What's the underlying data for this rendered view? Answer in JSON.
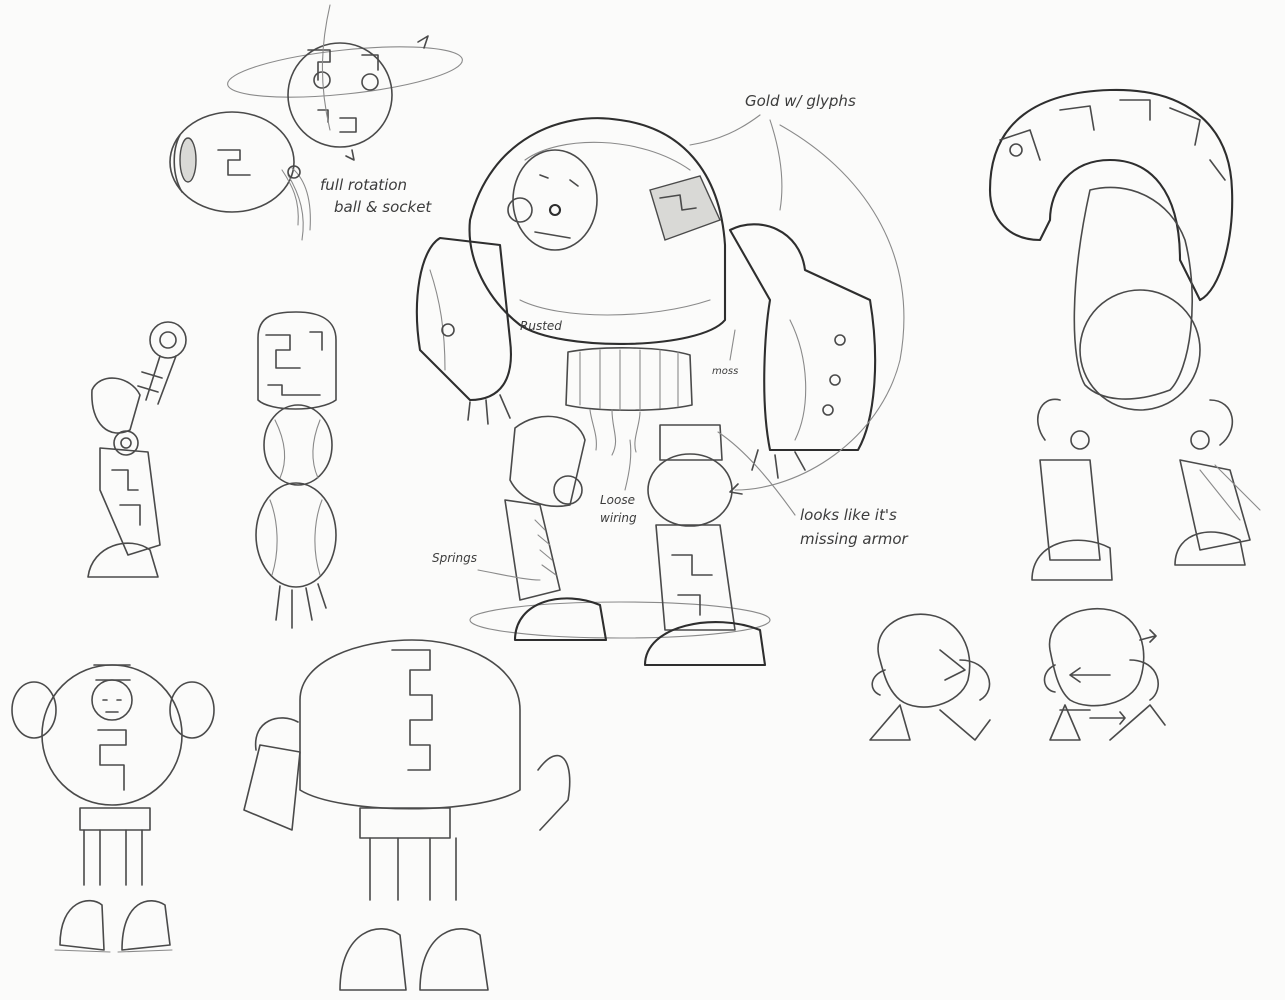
{
  "annotations": {
    "gold_glyphs": "Gold w/ glyphs",
    "rotation_line1": "full rotation",
    "rotation_line2": "ball & socket",
    "rusted": "Rusted",
    "moss": "moss",
    "loose_line1": "Loose",
    "loose_line2": "wiring",
    "springs": "Springs",
    "missing_line1": "looks like it's",
    "missing_line2": "missing armor"
  },
  "colors": {
    "paper": "#fbfbfa",
    "pencil": "#4a4a4a"
  }
}
